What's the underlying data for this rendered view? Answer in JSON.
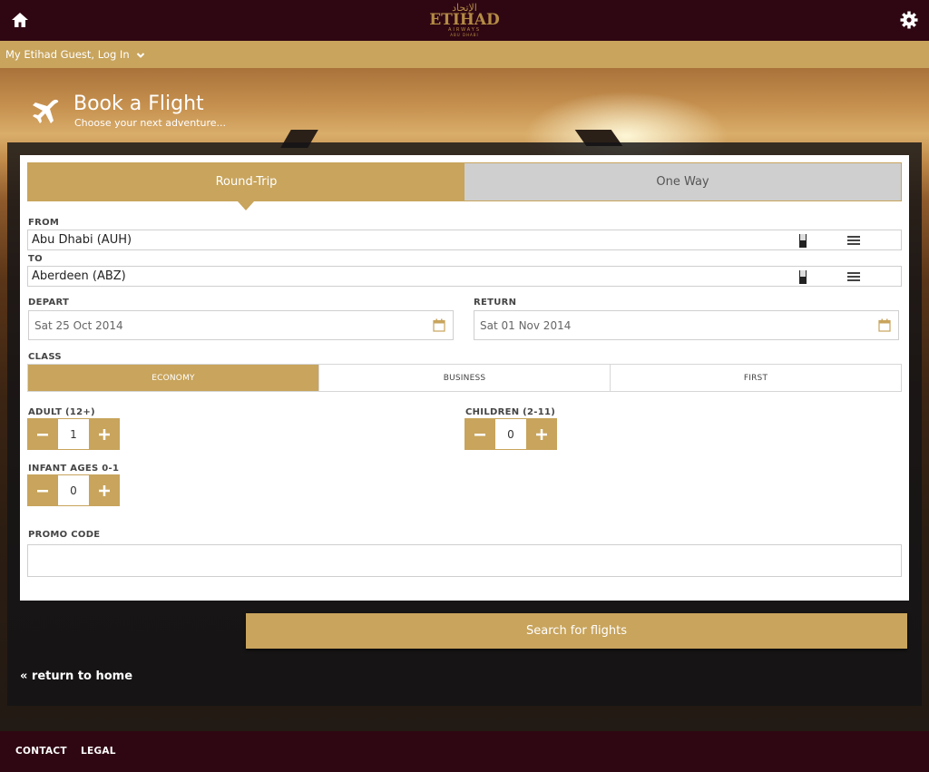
{
  "header": {
    "logo_arabic": "الإتحاد",
    "logo_brand": "ETIHAD",
    "logo_sub": "AIRWAYS",
    "logo_city": "ABU DHABI",
    "home_icon": "home-icon",
    "settings_icon": "gear-icon"
  },
  "account": {
    "label": "My Etihad Guest, Log In"
  },
  "hero": {
    "title": "Book a Flight",
    "subtitle": "Choose your next adventure..."
  },
  "trip": {
    "options": [
      "Round-Trip",
      "One Way"
    ],
    "selected": "Round-Trip"
  },
  "from": {
    "label": "FROM",
    "value": "Abu Dhabi (AUH)"
  },
  "to": {
    "label": "TO",
    "value": "Aberdeen (ABZ)"
  },
  "depart": {
    "label": "DEPART",
    "value": "Sat 25 Oct 2014"
  },
  "return": {
    "label": "RETURN",
    "value": "Sat 01 Nov 2014"
  },
  "cabin": {
    "label": "CLASS",
    "options": [
      "ECONOMY",
      "BUSINESS",
      "FIRST"
    ],
    "selected": "ECONOMY"
  },
  "passengers": {
    "adult": {
      "label": "ADULT (12+)",
      "count": "1"
    },
    "children": {
      "label": "CHILDREN (2-11)",
      "count": "0"
    },
    "infant": {
      "label": "INFANT AGES 0-1",
      "count": "0"
    }
  },
  "promo": {
    "label": "PROMO CODE",
    "value": ""
  },
  "search_button": "Search for flights",
  "return_home": "« return to home",
  "footer": {
    "contact": "CONTACT",
    "legal": "LEGAL"
  },
  "colors": {
    "gold": "#c8a45c",
    "maroon": "#2f0712",
    "inactive": "#cfcfcf"
  }
}
